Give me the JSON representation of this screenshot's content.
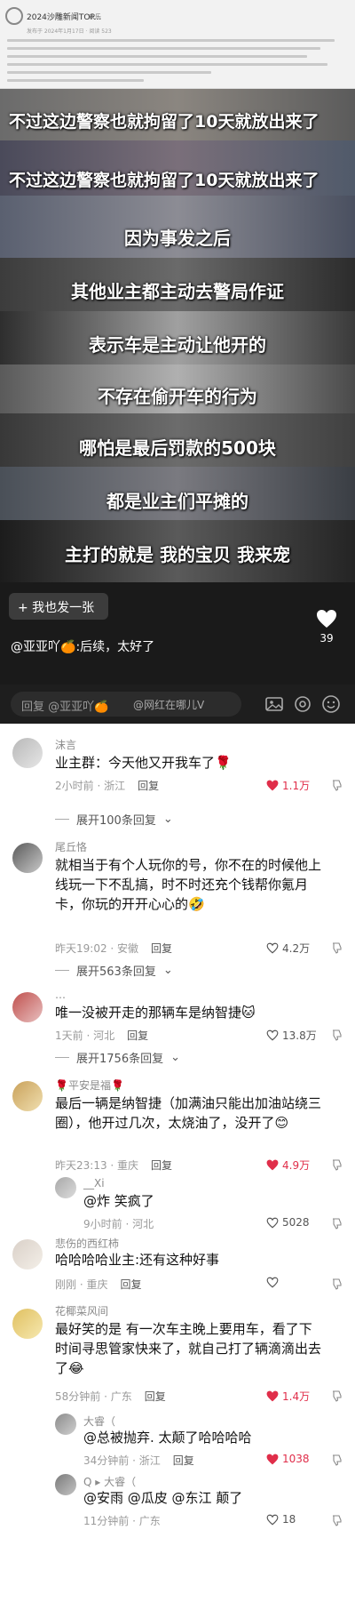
{
  "article": {
    "title": "2024沙雕新闻TOP...",
    "tag": "欢乐",
    "meta": "发布于 2024年1月17日 · 阅读 523"
  },
  "video": {
    "subtitles": [
      "不过这边警察也就拘留了10天就放出来了",
      "不过这边警察也就拘留了10天就放出来了",
      "因为事发之后",
      "其他业主都主动去警局作证",
      "表示车是主动让他开的",
      "不存在偷开车的行为",
      "哪怕是最后罚款的500块",
      "都是业主们平摊的",
      "主打的就是 我的宝贝 我来宠"
    ],
    "repost_button": "+ 我也发一张",
    "comment_user": "@亚亚吖🍊",
    "comment_text": ":后续，太好了",
    "like_count": "39",
    "reply_placeholder": "回复 @亚亚吖🍊",
    "watermark": "@网红在哪儿V"
  },
  "comments": [
    {
      "user": "沫言",
      "text": "业主群：今天他又开我车了🌹",
      "time": "2小时前 · 浙江",
      "reply": "回复",
      "likes": "1.1万",
      "liked": true
    },
    {
      "expand": "展开100条回复"
    },
    {
      "user": "尾丘恪",
      "text": "就相当于有个人玩你的号，你不在的时候他上线玩一下不乱搞，时不时还充个钱帮你氪月卡，你玩的开开心心的🤣",
      "time": "昨天19:02 · 安徽",
      "reply": "回复",
      "likes": "4.2万",
      "liked": false
    },
    {
      "expand": "展开563条回复"
    },
    {
      "user": "…",
      "text": "唯一没被开走的那辆车是纳智捷🐱",
      "time": "1天前 · 河北",
      "reply": "回复",
      "likes": "13.8万",
      "liked": false
    },
    {
      "expand": "展开1756条回复"
    },
    {
      "user": "🌹平安是福🌹",
      "text": "最后一辆是纳智捷（加满油只能出加油站绕三圈），他开过几次，太烧油了，没开了😊",
      "time": "昨天23:13 · 重庆",
      "reply": "回复",
      "likes": "4.9万",
      "liked": true
    },
    {
      "user": "__Xi",
      "text": "@炸 笑疯了",
      "time": "9小时前 · 河北",
      "reply": "",
      "likes": "5028",
      "liked": false,
      "sub": true
    },
    {
      "user": "悲伤的西红柿",
      "text": "哈哈哈哈业主:还有这种好事",
      "time": "刚刚 · 重庆",
      "reply": "回复",
      "likes": "",
      "liked": false
    },
    {
      "user": "花椰菜风间",
      "text": "最好笑的是 有一次车主晚上要用车，看了下时间寻思管家快来了，就自己打了辆滴滴出去了😂",
      "time": "58分钟前 · 广东",
      "reply": "回复",
      "likes": "1.4万",
      "liked": true
    },
    {
      "user": "大睿（",
      "text": "@总被抛弃. 太颠了哈哈哈哈",
      "time": "34分钟前 · 浙江",
      "reply": "回复",
      "likes": "1038",
      "liked": true,
      "sub": true
    },
    {
      "user": "Q ▸ 大睿（",
      "text": "@安雨 @瓜皮 @东江 颠了",
      "time": "11分钟前 · 广东",
      "reply": "",
      "likes": "18",
      "liked": false,
      "sub": true
    }
  ]
}
